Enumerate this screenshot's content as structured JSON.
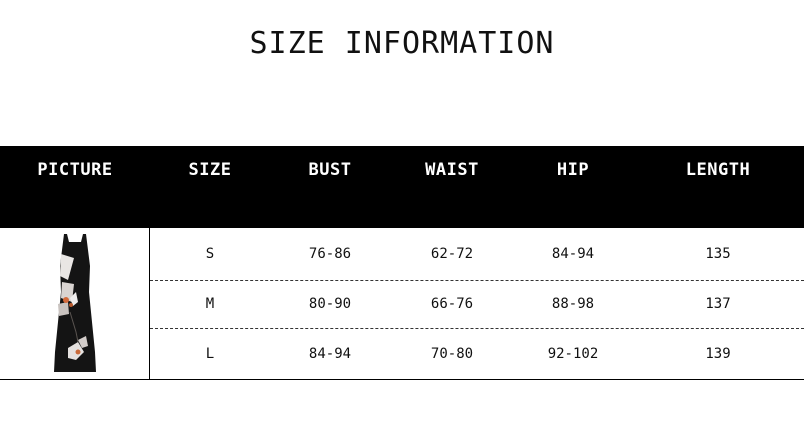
{
  "title": "SIZE INFORMATION",
  "headers": [
    "PICTURE",
    "SIZE",
    "BUST",
    "WAIST",
    "HIP",
    "LENGTH"
  ],
  "rows": [
    {
      "size": "S",
      "bust": "76-86",
      "waist": "62-72",
      "hip": "84-94",
      "length": "135"
    },
    {
      "size": "M",
      "bust": "80-90",
      "waist": "66-76",
      "hip": "88-98",
      "length": "137"
    },
    {
      "size": "L",
      "bust": "84-94",
      "waist": "70-80",
      "hip": "92-102",
      "length": "139"
    }
  ],
  "colors": {
    "header_bg": "#000000",
    "header_text": "#ffffff",
    "body_text": "#111111"
  },
  "picture": {
    "icon": "dress-product-photo"
  }
}
